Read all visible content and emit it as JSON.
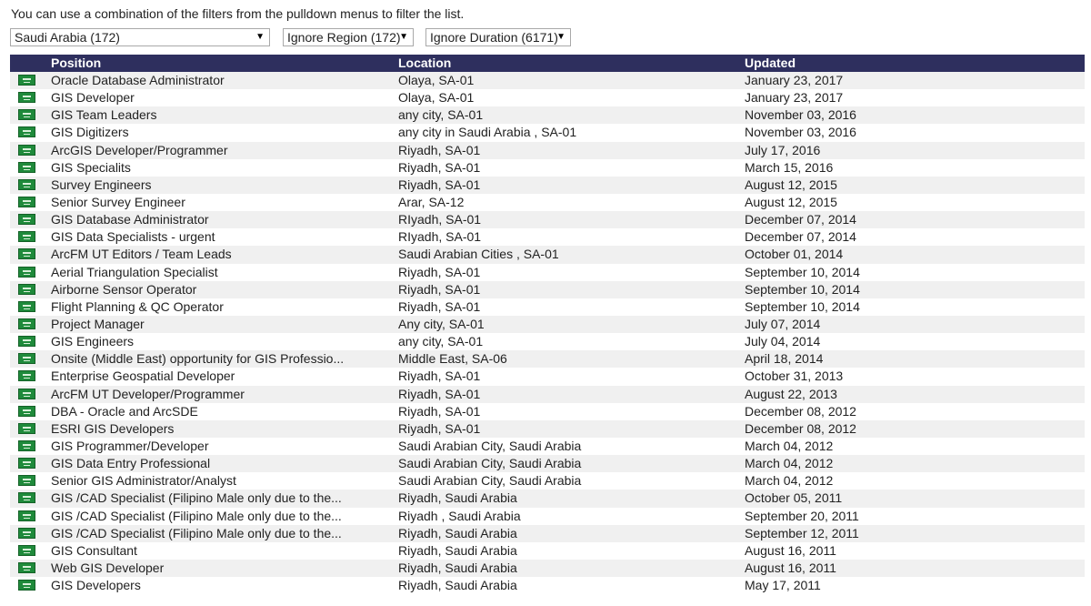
{
  "intro": "You can use a combination of the filters from the pulldown menus to filter the list.",
  "filters": {
    "country": "Saudi Arabia (172)",
    "region": "Ignore Region (172)",
    "duration": "Ignore Duration (6171)",
    "arrow": "▼"
  },
  "table": {
    "headers": {
      "position": "Position",
      "location": "Location",
      "updated": "Updated"
    },
    "rows": [
      {
        "position": "Oracle Database Administrator",
        "location": "Olaya, SA-01",
        "updated": "January 23, 2017"
      },
      {
        "position": "GIS Developer",
        "location": "Olaya, SA-01",
        "updated": "January 23, 2017"
      },
      {
        "position": "GIS Team Leaders",
        "location": "any city, SA-01",
        "updated": "November 03, 2016"
      },
      {
        "position": "GIS Digitizers",
        "location": "any city in Saudi Arabia , SA-01",
        "updated": "November 03, 2016"
      },
      {
        "position": "ArcGIS Developer/Programmer",
        "location": "Riyadh, SA-01",
        "updated": "July 17, 2016"
      },
      {
        "position": "GIS Specialits",
        "location": "Riyadh, SA-01",
        "updated": "March 15, 2016"
      },
      {
        "position": "Survey Engineers",
        "location": "Riyadh, SA-01",
        "updated": "August 12, 2015"
      },
      {
        "position": "Senior Survey Engineer",
        "location": "Arar, SA-12",
        "updated": "August 12, 2015"
      },
      {
        "position": "GIS Database Administrator",
        "location": "RIyadh, SA-01",
        "updated": "December 07, 2014"
      },
      {
        "position": "GIS Data Specialists - urgent",
        "location": "RIyadh, SA-01",
        "updated": "December 07, 2014"
      },
      {
        "position": "ArcFM UT Editors / Team Leads",
        "location": "Saudi Arabian Cities , SA-01",
        "updated": "October 01, 2014"
      },
      {
        "position": "Aerial Triangulation Specialist",
        "location": "Riyadh, SA-01",
        "updated": "September 10, 2014"
      },
      {
        "position": "Airborne Sensor Operator",
        "location": "Riyadh, SA-01",
        "updated": "September 10, 2014"
      },
      {
        "position": "Flight Planning & QC Operator",
        "location": "Riyadh, SA-01",
        "updated": "September 10, 2014"
      },
      {
        "position": "Project Manager",
        "location": "Any city, SA-01",
        "updated": "July 07, 2014"
      },
      {
        "position": "GIS Engineers",
        "location": "any city, SA-01",
        "updated": "July 04, 2014"
      },
      {
        "position": "Onsite (Middle East) opportunity for GIS Professio...",
        "location": "Middle East, SA-06",
        "updated": "April 18, 2014"
      },
      {
        "position": "Enterprise Geospatial Developer",
        "location": "Riyadh, SA-01",
        "updated": "October 31, 2013"
      },
      {
        "position": "ArcFM UT Developer/Programmer",
        "location": "Riyadh, SA-01",
        "updated": "August 22, 2013"
      },
      {
        "position": "DBA - Oracle and ArcSDE",
        "location": "Riyadh, SA-01",
        "updated": "December 08, 2012"
      },
      {
        "position": "ESRI GIS Developers",
        "location": "Riyadh, SA-01",
        "updated": "December 08, 2012"
      },
      {
        "position": "GIS Programmer/Developer",
        "location": "Saudi Arabian City, Saudi Arabia",
        "updated": "March 04, 2012"
      },
      {
        "position": "GIS Data Entry Professional",
        "location": "Saudi Arabian City, Saudi Arabia",
        "updated": "March 04, 2012"
      },
      {
        "position": "Senior GIS Administrator/Analyst",
        "location": "Saudi Arabian City, Saudi Arabia",
        "updated": "March 04, 2012"
      },
      {
        "position": "GIS /CAD Specialist (Filipino Male only due to the...",
        "location": "Riyadh, Saudi Arabia",
        "updated": "October 05, 2011"
      },
      {
        "position": "GIS /CAD Specialist (Filipino Male only due to the...",
        "location": "Riyadh , Saudi Arabia",
        "updated": "September 20, 2011"
      },
      {
        "position": "GIS /CAD Specialist (Filipino Male only due to the...",
        "location": "Riyadh, Saudi Arabia",
        "updated": "September 12, 2011"
      },
      {
        "position": "GIS Consultant",
        "location": "Riyadh, Saudi Arabia",
        "updated": "August 16, 2011"
      },
      {
        "position": "Web GIS Developer",
        "location": "Riyadh, Saudi Arabia",
        "updated": "August 16, 2011"
      },
      {
        "position": "GIS Developers",
        "location": "Riyadh, Saudi Arabia",
        "updated": "May 17, 2011"
      }
    ]
  },
  "icons": {
    "row_flag": "saudi-flag-icon"
  },
  "colors": {
    "header_bg": "#2e2f5e",
    "row_alt_bg": "#f0f0f0",
    "flag_green": "#1f8a3b"
  }
}
